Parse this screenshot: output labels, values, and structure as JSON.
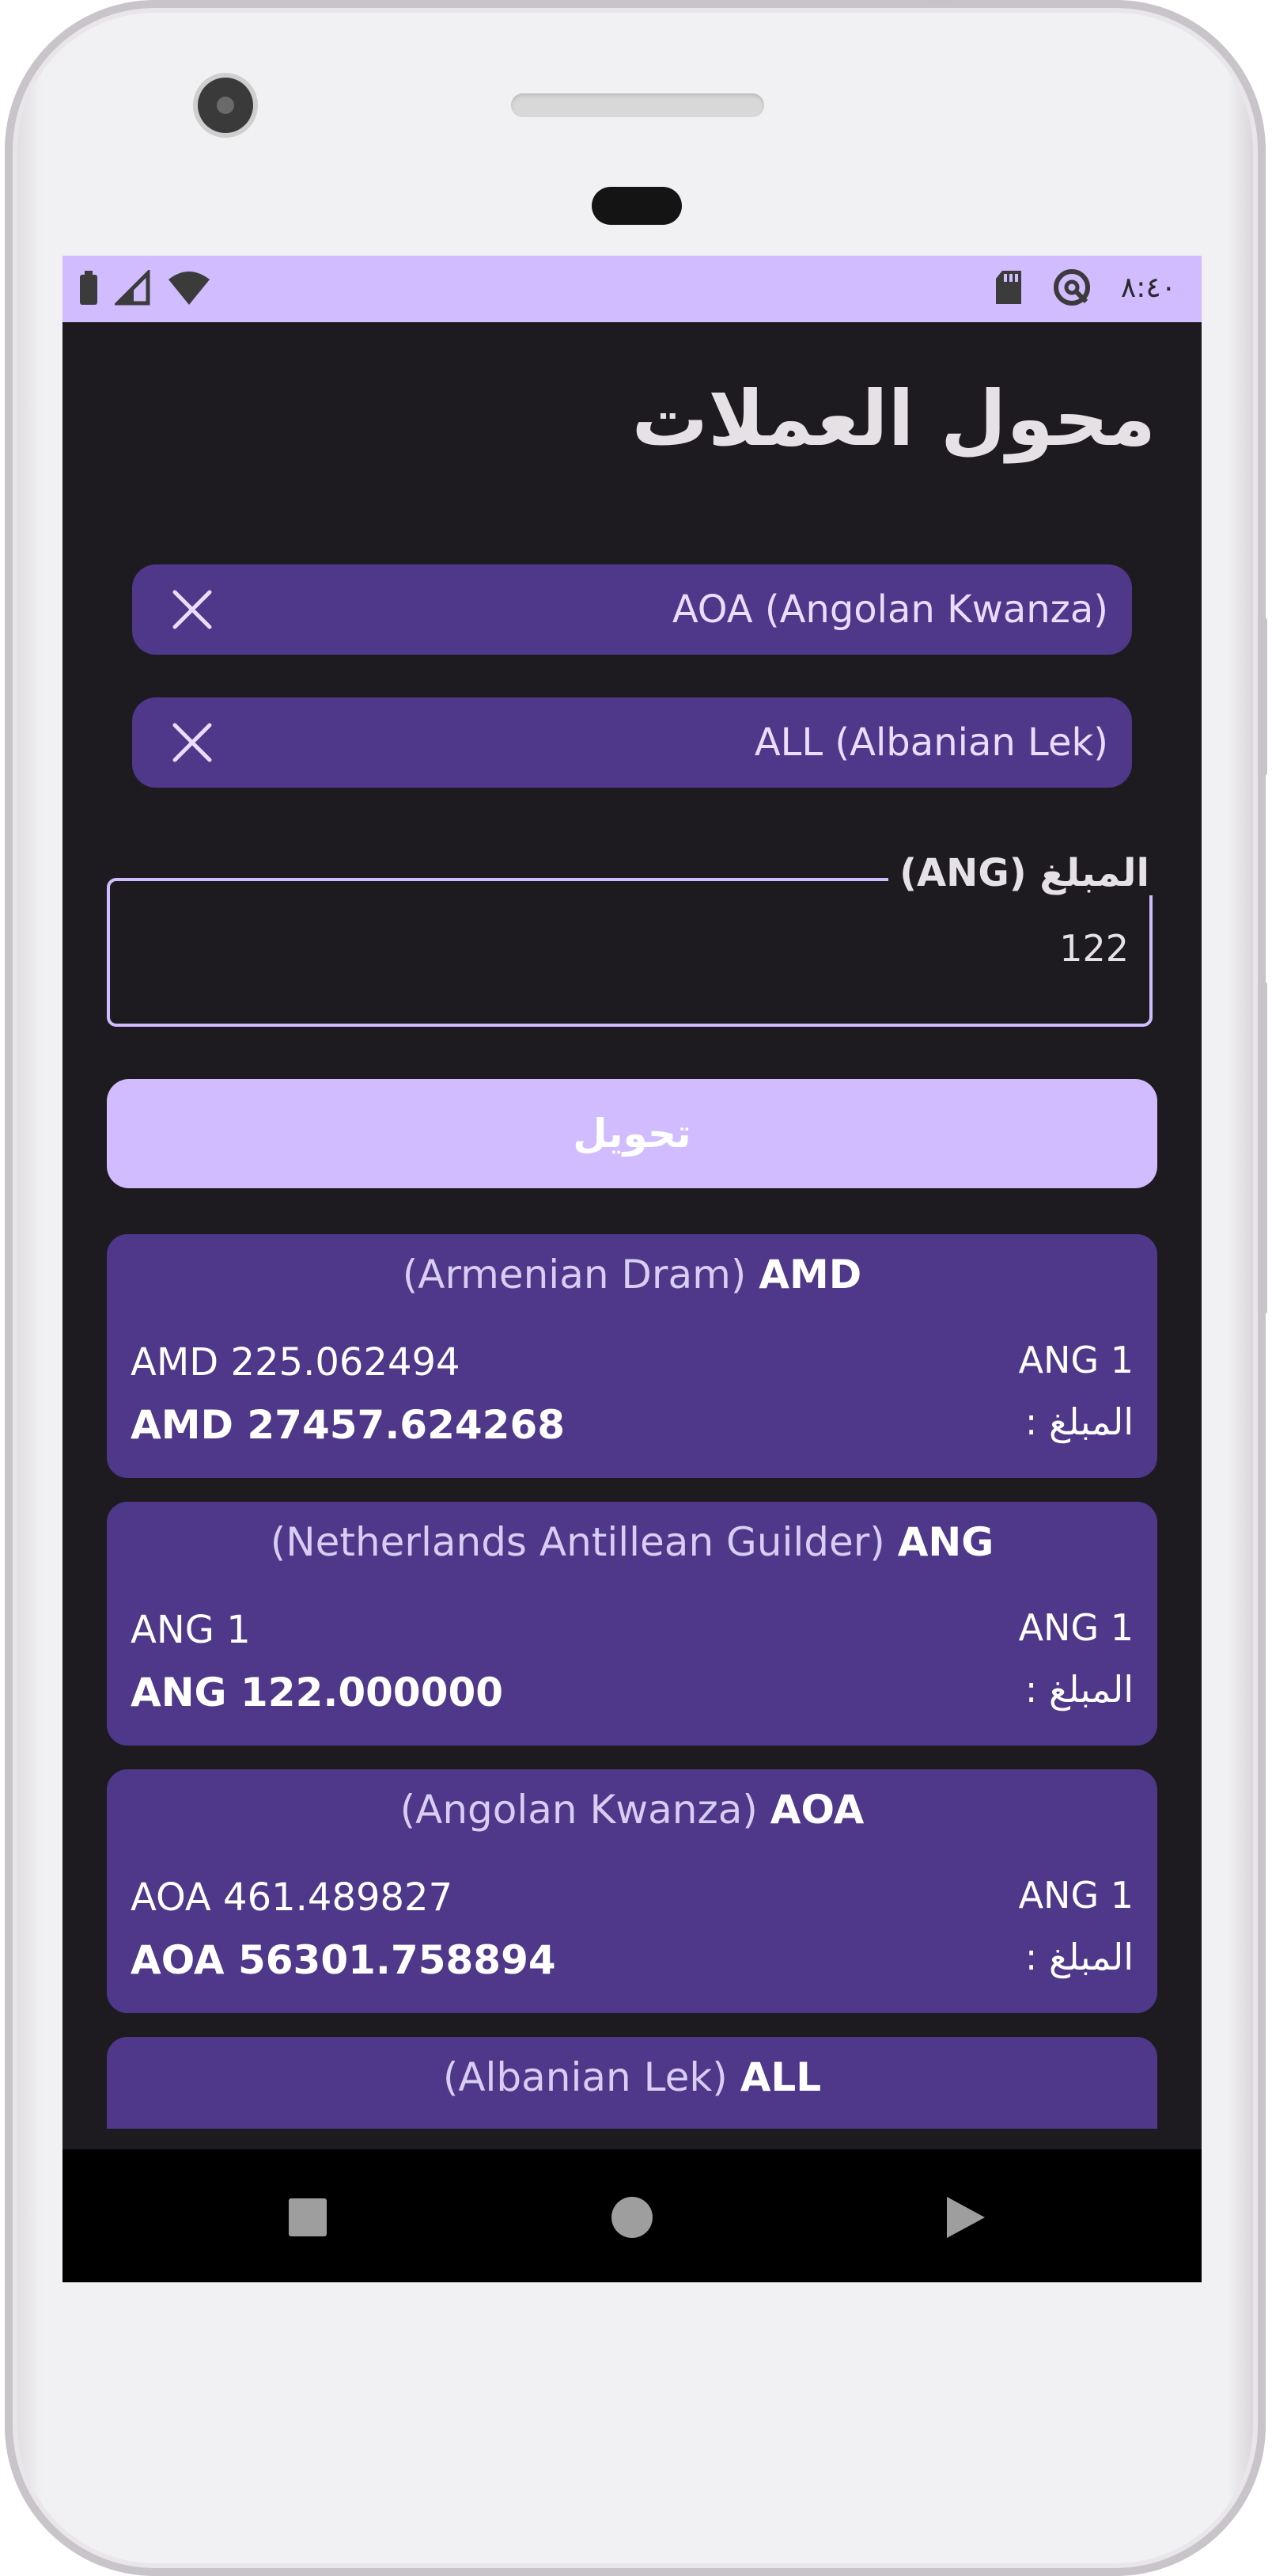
{
  "status_bar": {
    "time": "٨:٤٠",
    "icons_left": [
      "battery-icon",
      "signal-icon",
      "wifi-icon"
    ],
    "icons_right": [
      "sd-card-icon",
      "data-saver-icon"
    ]
  },
  "header": {
    "title": "محول العملات"
  },
  "selected_currencies": [
    {
      "label": "AOA (Angolan Kwanza)"
    },
    {
      "label": "ALL (Albanian Lek)"
    }
  ],
  "amount_field": {
    "label": "المبلغ (ANG)",
    "value": "122"
  },
  "convert_button": {
    "label": "تحويل"
  },
  "results": [
    {
      "code": "AMD",
      "name": "(Armenian Dram)",
      "rate": "AMD 225.062494",
      "amount": "AMD 27457.624268",
      "base": "ANG 1",
      "amount_label": "المبلغ :"
    },
    {
      "code": "ANG",
      "name": "(Netherlands Antillean Guilder)",
      "rate": "ANG 1",
      "amount": "ANG 122.000000",
      "base": "ANG 1",
      "amount_label": "المبلغ :"
    },
    {
      "code": "AOA",
      "name": "(Angolan Kwanza)",
      "rate": "AOA 461.489827",
      "amount": "AOA 56301.758894",
      "base": "ANG 1",
      "amount_label": "المبلغ :"
    },
    {
      "code": "ALL",
      "name": "(Albanian Lek)"
    }
  ],
  "nav_bar": {
    "icons": [
      "recents-square-icon",
      "home-circle-icon",
      "back-triangle-icon"
    ]
  },
  "colors": {
    "accent": "#d0bcfe",
    "card": "#4f378a",
    "background": "#1d1b20"
  }
}
